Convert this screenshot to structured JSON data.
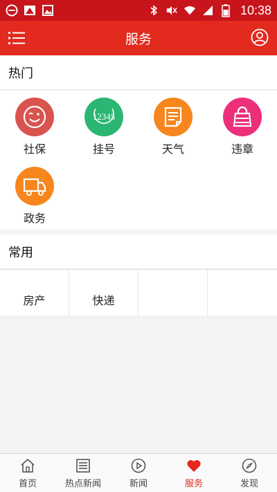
{
  "status_bar": {
    "time": "10:38"
  },
  "app_bar": {
    "title": "服务"
  },
  "hot": {
    "title": "热门",
    "items": [
      {
        "label": "社保",
        "icon": "smiley-face-icon",
        "color": "#d9534f"
      },
      {
        "label": "挂号",
        "icon": "hotline-12345-icon",
        "color": "#2bb673",
        "icon_text": "12345"
      },
      {
        "label": "天气",
        "icon": "document-note-icon",
        "color": "#f7861d"
      },
      {
        "label": "违章",
        "icon": "handbag-icon",
        "color": "#ec2f7b"
      },
      {
        "label": "政务",
        "icon": "delivery-truck-icon",
        "color": "#f7861d"
      }
    ]
  },
  "common": {
    "title": "常用",
    "items": [
      {
        "label": "房产"
      },
      {
        "label": "快递"
      },
      {
        "label": ""
      },
      {
        "label": ""
      }
    ]
  },
  "tabs": [
    {
      "label": "首页",
      "icon": "home-icon",
      "active": false
    },
    {
      "label": "热点新闻",
      "icon": "news-list-icon",
      "active": false
    },
    {
      "label": "新闻",
      "icon": "play-circle-icon",
      "active": false
    },
    {
      "label": "服务",
      "icon": "heart-icon",
      "active": true
    },
    {
      "label": "发现",
      "icon": "compass-icon",
      "active": false
    }
  ],
  "colors": {
    "brand_red": "#e22a1f",
    "status_red": "#c8141b",
    "background": "#f3f3f3"
  }
}
